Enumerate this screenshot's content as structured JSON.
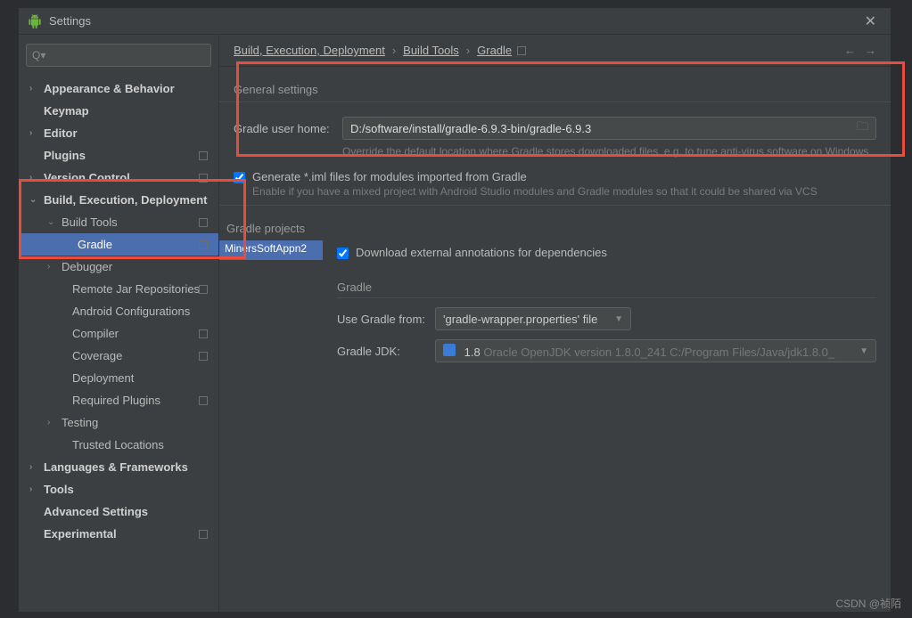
{
  "titlebar": {
    "title": "Settings"
  },
  "search": {
    "placeholder": ""
  },
  "sidebar": {
    "items": [
      {
        "label": "Appearance & Behavior",
        "bold": true,
        "chev": "›"
      },
      {
        "label": "Keymap",
        "bold": true
      },
      {
        "label": "Editor",
        "bold": true,
        "chev": "›"
      },
      {
        "label": "Plugins",
        "bold": true,
        "badge": true
      },
      {
        "label": "Version Control",
        "bold": true,
        "chev": "›",
        "badge": true
      },
      {
        "label": "Build, Execution, Deployment",
        "bold": true,
        "chev": "⌄"
      },
      {
        "label": "Build Tools",
        "chev": "⌄",
        "lvl": 1,
        "badge": true
      },
      {
        "label": "Gradle",
        "lvl": 2,
        "selected": true,
        "badge": true
      },
      {
        "label": "Debugger",
        "chev": "›",
        "lvl": 1
      },
      {
        "label": "Remote Jar Repositories",
        "lvl": "1c",
        "badge": true
      },
      {
        "label": "Android Configurations",
        "lvl": "1c"
      },
      {
        "label": "Compiler",
        "lvl": "1c",
        "badge": true
      },
      {
        "label": "Coverage",
        "lvl": "1c",
        "badge": true
      },
      {
        "label": "Deployment",
        "lvl": "1c"
      },
      {
        "label": "Required Plugins",
        "lvl": "1c",
        "badge": true
      },
      {
        "label": "Testing",
        "chev": "›",
        "lvl": 1
      },
      {
        "label": "Trusted Locations",
        "lvl": "1c"
      },
      {
        "label": "Languages & Frameworks",
        "bold": true,
        "chev": "›"
      },
      {
        "label": "Tools",
        "bold": true,
        "chev": "›"
      },
      {
        "label": "Advanced Settings",
        "bold": true
      },
      {
        "label": "Experimental",
        "bold": true,
        "badge": true
      }
    ]
  },
  "breadcrumb": {
    "seg1": "Build, Execution, Deployment",
    "seg2": "Build Tools",
    "seg3": "Gradle"
  },
  "general": {
    "title": "General settings",
    "userHomeLabel": "Gradle user home:",
    "userHomeValue": "D:/software/install/gradle-6.9.3-bin/gradle-6.9.3",
    "userHomeHint": "Override the default location where Gradle stores downloaded files, e.g. to tune anti-virus software on Windows",
    "genImlLabel": "Generate *.iml files for modules imported from Gradle",
    "genImlHint": "Enable if you have a mixed project with Android Studio modules and Gradle modules so that it could be shared via VCS"
  },
  "projects": {
    "title": "Gradle projects",
    "item": "MinersSoftAppn2",
    "downloadAnnotations": "Download external annotations for dependencies",
    "gradleHeader": "Gradle",
    "useFromLabel": "Use Gradle from:",
    "useFromValue": "'gradle-wrapper.properties' file",
    "jdkLabel": "Gradle JDK:",
    "jdkValue": "1.8",
    "jdkDetail": "Oracle OpenJDK version 1.8.0_241 C:/Program Files/Java/jdk1.8.0_"
  },
  "watermark": "CSDN @祯陌"
}
